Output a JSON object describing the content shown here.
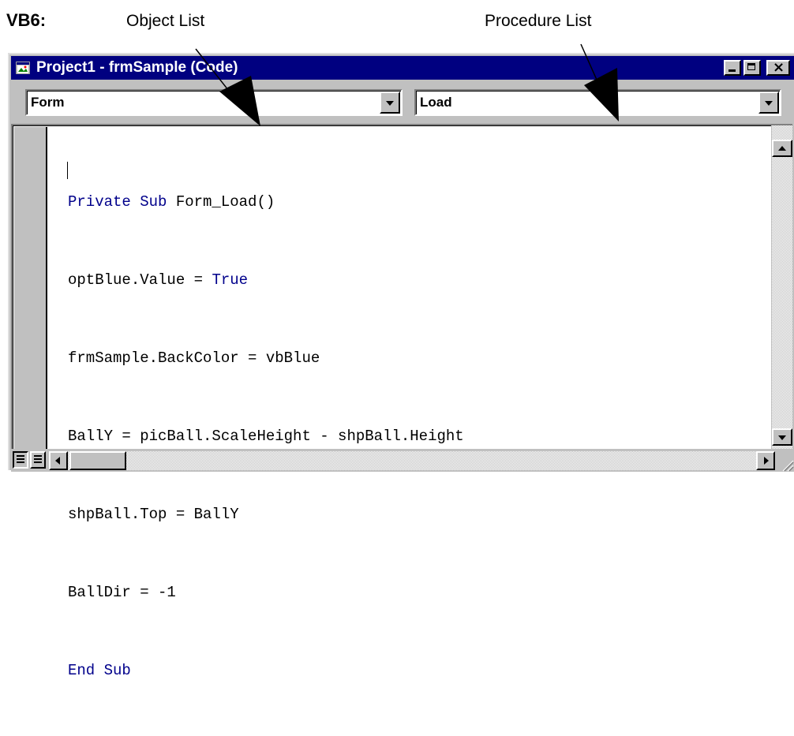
{
  "annotations": {
    "heading": "VB6:",
    "object_list_label": "Object List",
    "procedure_list_label": "Procedure List"
  },
  "window": {
    "title": "Project1 - frmSample (Code)",
    "title_bar_color": "#000080",
    "icons": [
      "form-icon",
      "minimize-icon",
      "maximize-icon",
      "close-icon"
    ]
  },
  "object_combo": {
    "value": "Form"
  },
  "procedure_combo": {
    "value": "Load"
  },
  "code": {
    "keyword_color": "#00008b",
    "lines": [
      "Private Sub Form_Load()",
      "optBlue.Value = True",
      "frmSample.BackColor = vbBlue",
      "BallY = picBall.ScaleHeight - shpBall.Height",
      "shpBall.Top = BallY",
      "BallDir = -1",
      "End Sub"
    ]
  },
  "bottom_bar": {
    "icons": [
      "procedure-view-icon",
      "full-module-view-icon"
    ]
  }
}
